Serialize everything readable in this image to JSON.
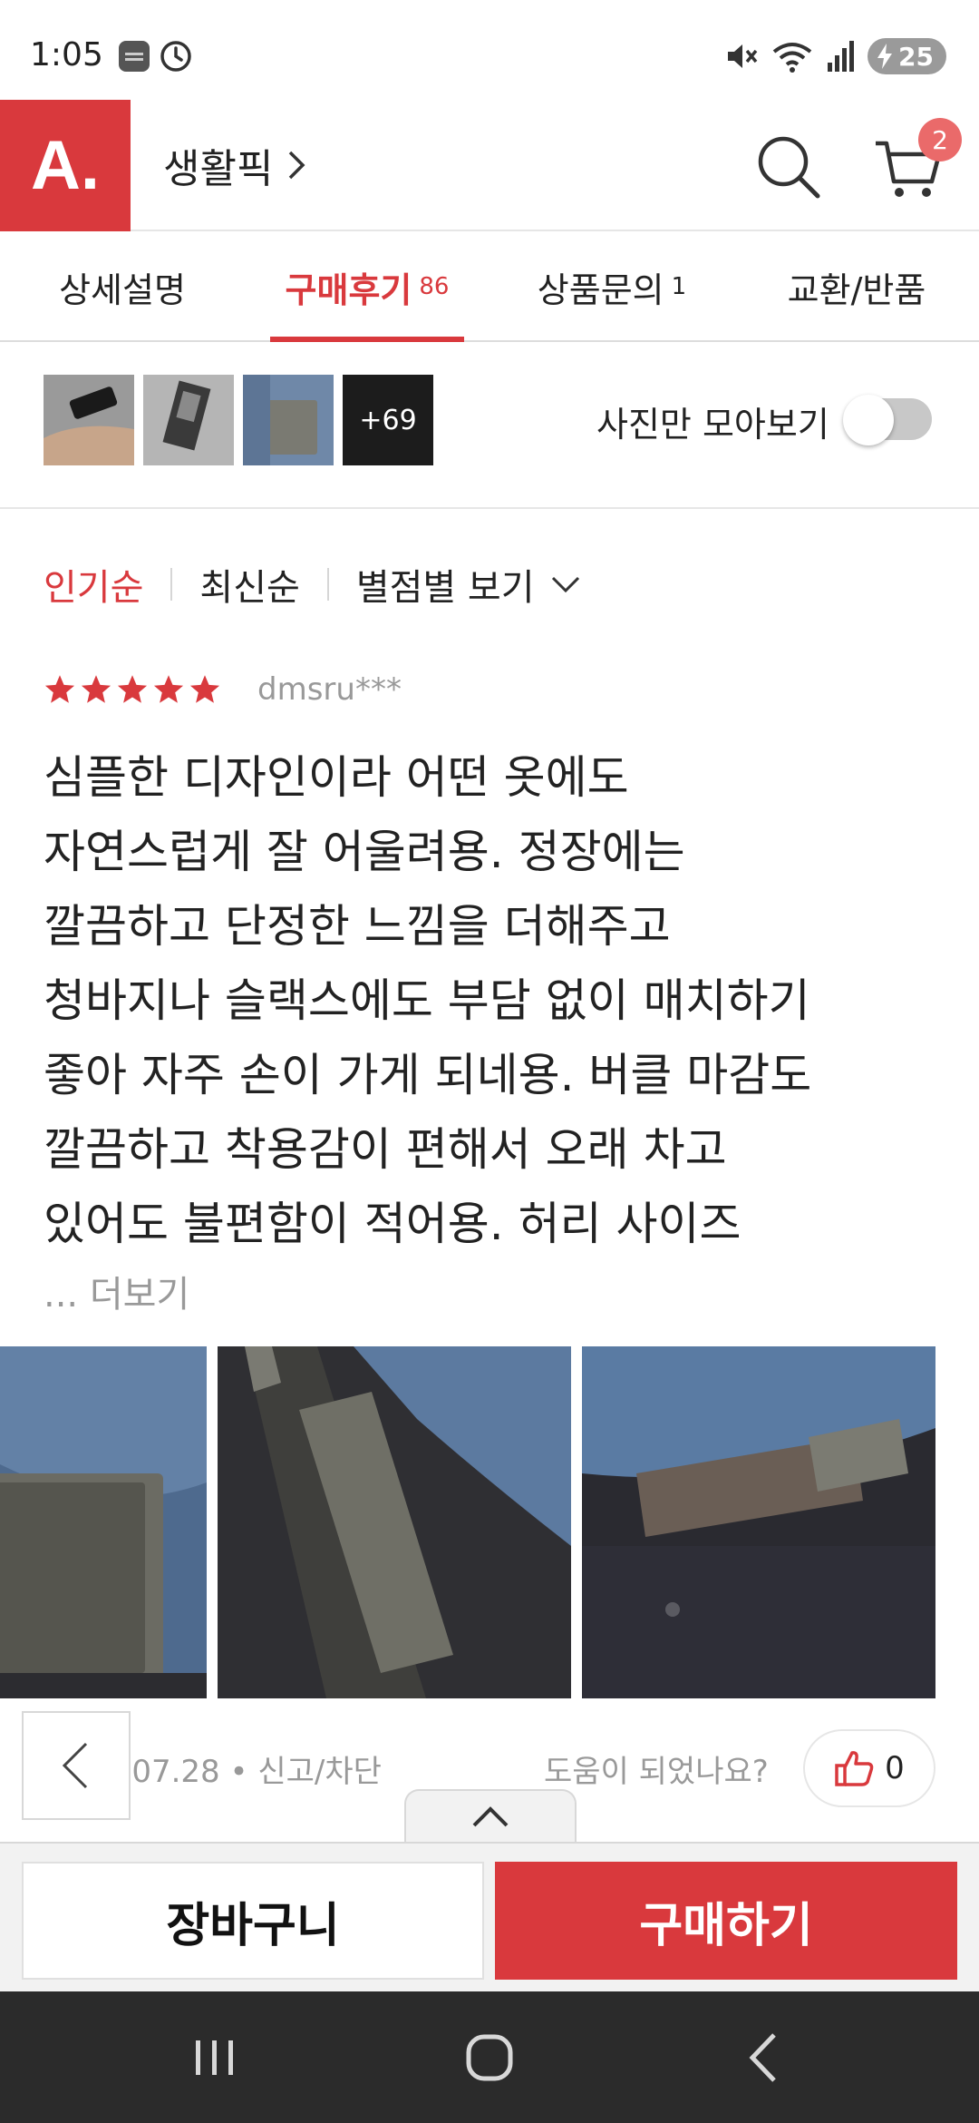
{
  "status_bar": {
    "time": "1:05",
    "battery": "25",
    "icons": [
      "samsung-health-icon",
      "clock-icon",
      "mute-icon",
      "wifi-icon",
      "signal-icon",
      "battery-icon"
    ]
  },
  "header": {
    "logo": "A.",
    "category": "생활픽",
    "cart_count": "2",
    "icons": [
      "search-icon",
      "cart-icon",
      "chevron-right-icon"
    ]
  },
  "tabs": [
    {
      "label": "상세설명",
      "count": ""
    },
    {
      "label": "구매후기",
      "count": "86"
    },
    {
      "label": "상품문의",
      "count": "1"
    },
    {
      "label": "교환/반품",
      "count": ""
    }
  ],
  "photo_strip": {
    "more_count": "+69",
    "photo_only_label": "사진만 모아보기",
    "photo_only_on": false
  },
  "sort": {
    "options": [
      "인기순",
      "최신순"
    ],
    "filter_label": "별점별 보기"
  },
  "review": {
    "rating": 5,
    "reviewer": "dmsru***",
    "text": [
      "심플한 디자인이라 어떤 옷에도",
      "자연스럽게 잘 어울려용. 정장에는",
      "깔끔하고 단정한 느낌을 더해주고",
      "청바지나 슬랙스에도 부담 없이 매치하기",
      "좋아 자주 손이 가게 되네용. 버클 마감도",
      "깔끔하고 착용감이 편해서 오래 차고",
      "있어도 불편함이 적어용. 허리 사이즈"
    ],
    "more": "... 더보기",
    "date": "2026.07.28",
    "report": "신고/차단",
    "helpful_question": "도움이 되었나요?",
    "helpful_count": "0"
  },
  "purchase": {
    "cart_label": "장바구니",
    "buy_label": "구매하기"
  },
  "colors": {
    "accent": "#d9393d",
    "badge": "#ea6a6a",
    "nav_bar": "#2b2b2b"
  }
}
